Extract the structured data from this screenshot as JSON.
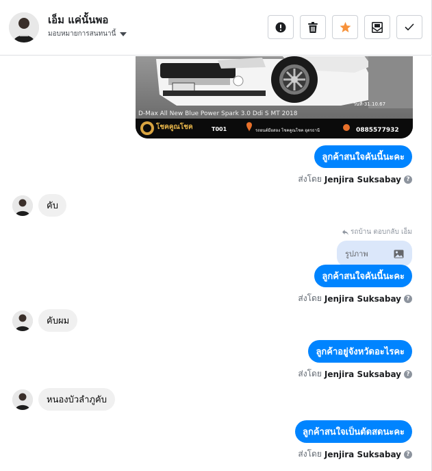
{
  "header": {
    "contact_name": "เอ็ม แค่นั้นพอ",
    "assign_label": "มอบหมายการสนทนานี้",
    "actions": [
      "alert-icon",
      "trash-icon",
      "star-icon",
      "mail-icon",
      "check-icon"
    ],
    "star_color": "#f7923b"
  },
  "car_image": {
    "model_text": "D-Max All New Blue Power Spark 3.0 Ddi S MT 2018",
    "date_text": "วันที่-31.10.67",
    "brand": "โชคคูณโชค",
    "code": "T001",
    "dealer": "รถยนต์มือสอง โชคคูณโชค อุดรธานี",
    "phone": "0885577932"
  },
  "messages": {
    "m1": {
      "text": "ลูกค้าสนใจคันนี้นะคะ",
      "sent_prefix": "ส่งโดย",
      "sender": "Jenjira Suksabay"
    },
    "m2": {
      "text": "คับ"
    },
    "m3": {
      "reply_meta": "รถบ้าน ตอบกลับ เอ็ม",
      "quoted_text": "รูปภาพ",
      "text": "ลูกค้าสนใจคันนี้นะคะ",
      "sent_prefix": "ส่งโดย",
      "sender": "Jenjira Suksabay"
    },
    "m4": {
      "text": "คับผม"
    },
    "m5": {
      "text": "ลูกค้าอยู่จังหวัดอะไรคะ",
      "sent_prefix": "ส่งโดย",
      "sender": "Jenjira Suksabay"
    },
    "m6": {
      "text": "หนองบัวลำภูคับ"
    },
    "m7": {
      "text": "ลูกค้าสนใจเป็นตัดสดนะคะ",
      "sent_prefix": "ส่งโดย",
      "sender": "Jenjira Suksabay"
    }
  },
  "colors": {
    "outgoing": "#0084ff",
    "incoming": "#f0f0f0",
    "quoted": "#dbe7fa"
  }
}
